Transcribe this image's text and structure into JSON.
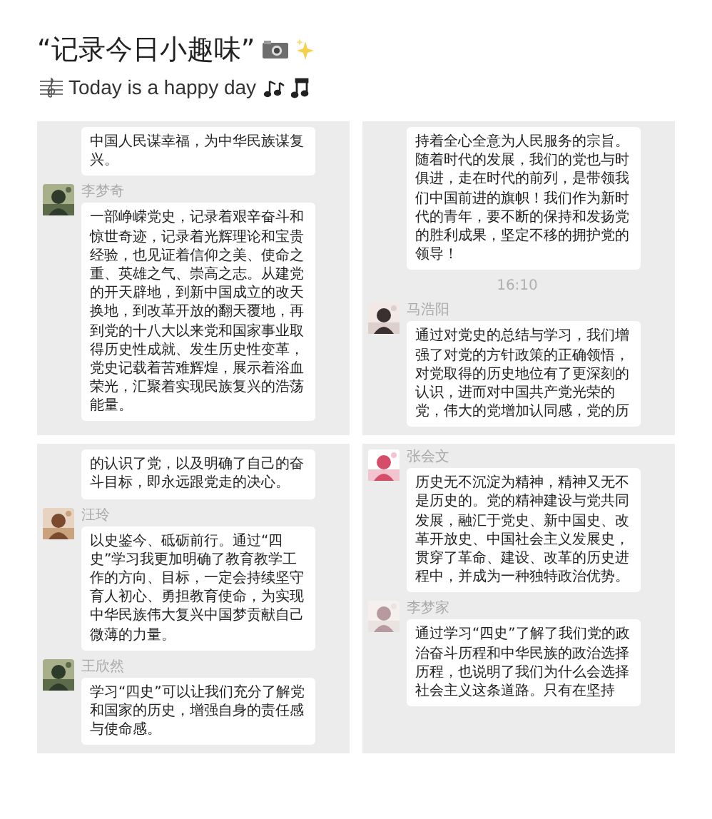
{
  "header": {
    "title": "“记录今日小趣味”",
    "subtitle": "Today is a happy day"
  },
  "panels": [
    {
      "items": [
        {
          "kind": "message",
          "text": "中国人民谋幸福，为中华民族谋复兴。"
        },
        {
          "kind": "message",
          "sender": "李梦奇",
          "text": "一部峥嵘党史，记录着艰辛奋斗和惊世奇迹，记录着光辉理论和宝贵经验，也见证着信仰之美、使命之重、英雄之气、崇高之志。从建党的开天辟地，到新中国成立的改天换地，到改革开放的翻天覆地，再到党的十八大以来党和国家事业取得历史性成就、发生历史性变革，党史记载着苦难辉煌，展示着浴血荣光，汇聚着实现民族复兴的浩荡能量。"
        }
      ]
    },
    {
      "items": [
        {
          "kind": "message",
          "text": "持着全心全意为人民服务的宗旨。随着时代的发展，我们的党也与时俱进，走在时代的前列，是带领我们中国前进的旗帜！我们作为新时代的青年，要不断的保持和发扬党的胜利成果，坚定不移的拥护党的领导！"
        },
        {
          "kind": "time",
          "text": "16:10"
        },
        {
          "kind": "message",
          "sender": "马浩阳",
          "text": "通过对党史的总结与学习，我们增强了对党的方针政策的正确领悟，对党取得的历史地位有了更深刻的认识，进而对中国共产党光荣的党，伟大的党增加认同感，党的历"
        }
      ]
    },
    {
      "items": [
        {
          "kind": "message",
          "text": "的认识了党，以及明确了自己的奋斗目标，即永远跟党走的决心。"
        },
        {
          "kind": "message",
          "sender": "汪玲",
          "text": "以史鉴今、砥砺前行。通过“四史”学习我更加明确了教育教学工作的方向、目标，一定会持续坚守育人初心、勇担教育使命，为实现中华民族伟大复兴中国梦贡献自己微薄的力量。"
        },
        {
          "kind": "message",
          "sender": "王欣然",
          "text": "学习“四史”可以让我们充分了解党和国家的历史，增强自身的责任感与使命感。"
        }
      ]
    },
    {
      "items": [
        {
          "kind": "message",
          "sender": "张会文",
          "text": "历史无不沉淀为精神，精神又无不是历史的。党的精神建设与党共同发展，融汇于党史、新中国史、改革开放史、中国社会主义发展史，贯穿了革命、建设、改革的历史进程中，并成为一种独特政治优势。"
        },
        {
          "kind": "message",
          "sender": "李梦家",
          "text": "通过学习“四史”了解了我们党的政治奋斗历程和中华民族的政治选择历程，也说明了我们为什么会选择社会主义这条道路。只有在坚持"
        }
      ]
    }
  ]
}
